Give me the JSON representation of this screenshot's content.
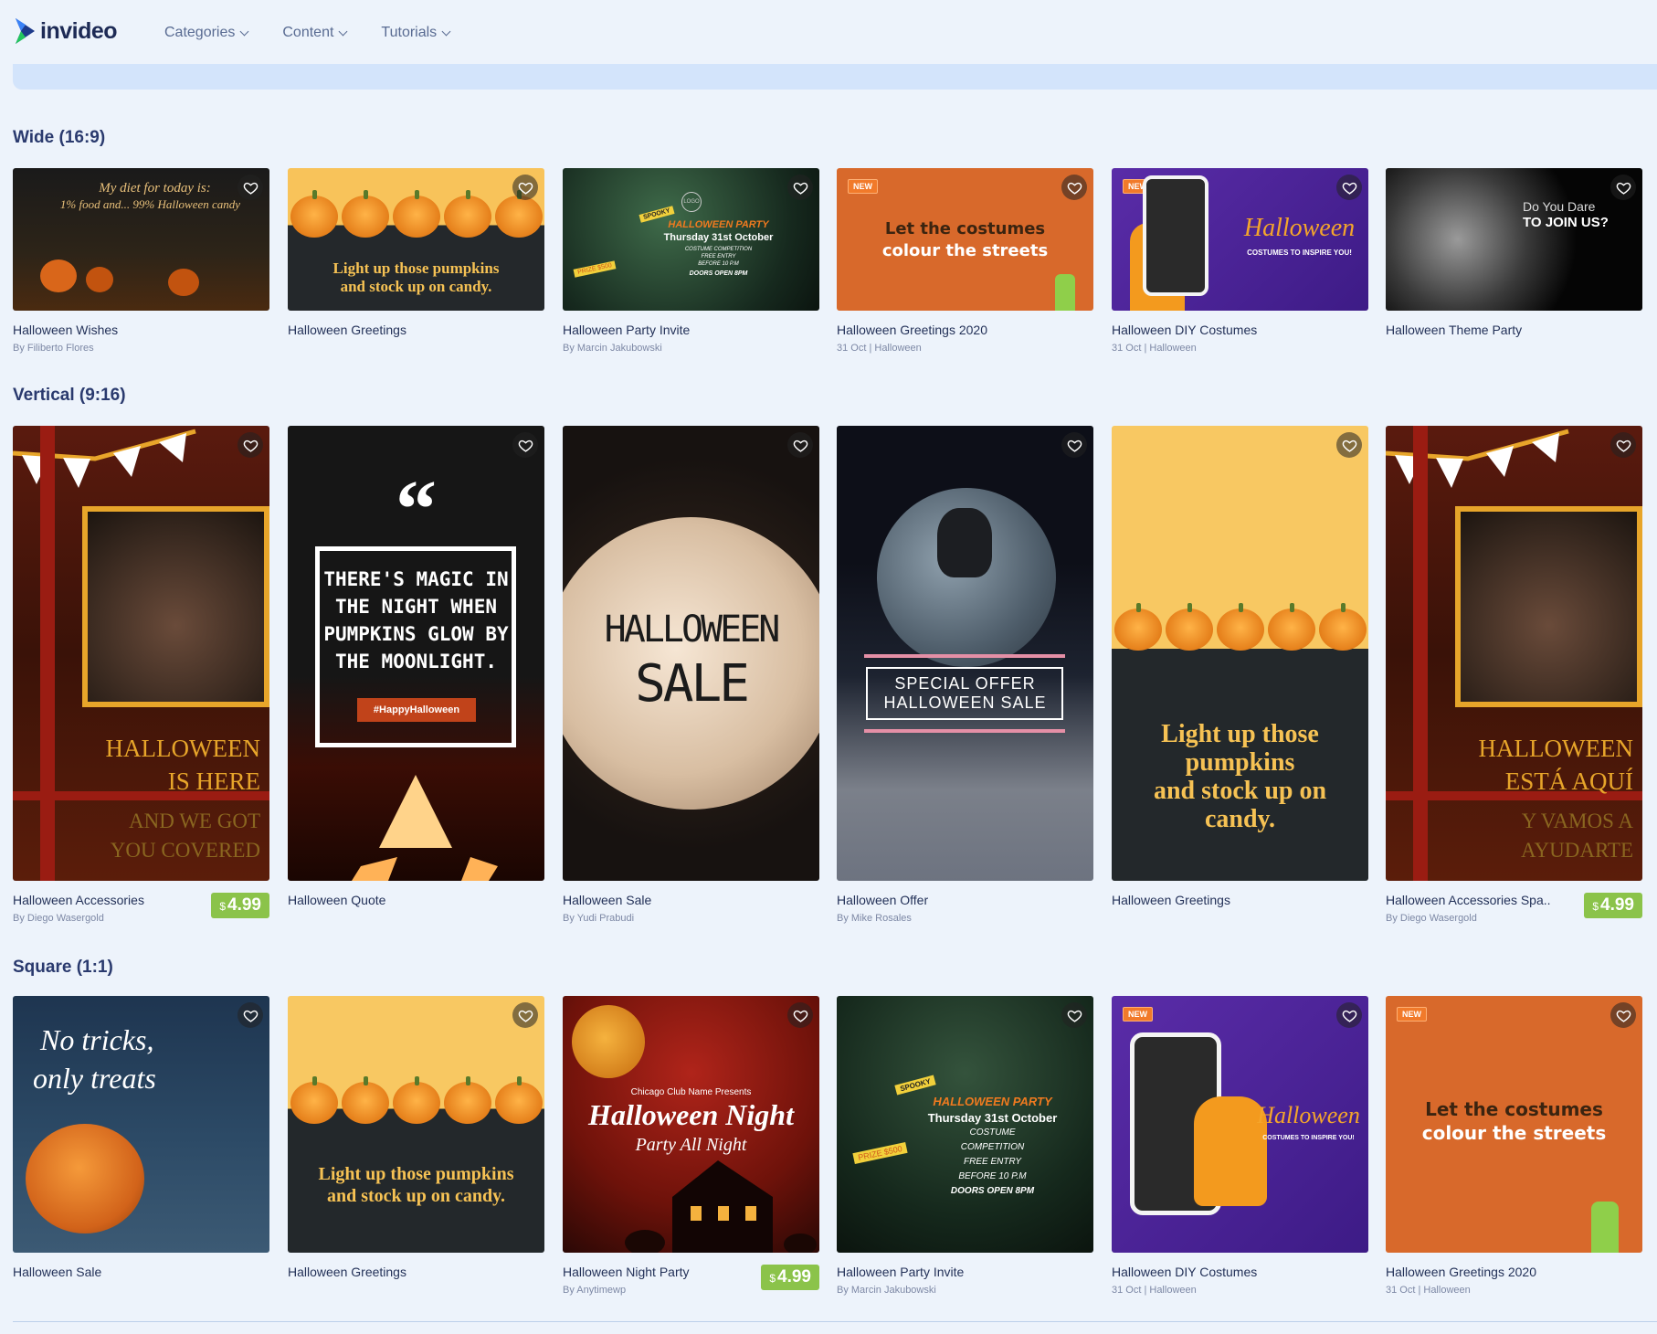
{
  "nav": {
    "logo": "invideo",
    "menu": [
      {
        "label": "Categories"
      },
      {
        "label": "Content"
      },
      {
        "label": "Tutorials"
      }
    ]
  },
  "colors": {
    "background": "#edf3fb",
    "banner": "#d3e4fb",
    "price": "#8bc34a",
    "new_badge": "#f17a2a"
  },
  "sections": {
    "wide": {
      "title": "Wide (16:9)",
      "cards": [
        {
          "title": "Halloween Wishes",
          "sub": "By Filiberto Flores",
          "thumb_text": [
            "My diet for today is:",
            "1% food and... 99% Halloween candy"
          ]
        },
        {
          "title": "Halloween Greetings",
          "sub": "",
          "thumb_text": [
            "Light up those pumpkins",
            "and stock up on candy."
          ]
        },
        {
          "title": "Halloween Party Invite",
          "sub": "By Marcin Jakubowski",
          "thumb_text": [
            "SPOOKY",
            "HALLOWEEN PARTY",
            "Thursday 31st October",
            "COSTUME COMPETITION",
            "FREE ENTRY",
            "BEFORE 10 P.M",
            "DOORS OPEN 8PM",
            "PRIZE $500",
            "LOGO"
          ]
        },
        {
          "title": "Halloween Greetings 2020",
          "sub": "31 Oct | Halloween",
          "badge": "NEW",
          "thumb_text": [
            "Let the costumes",
            "colour the streets"
          ]
        },
        {
          "title": "Halloween DIY Costumes",
          "sub": "31 Oct | Halloween",
          "badge": "NEW",
          "thumb_text": [
            "Halloween",
            "COSTUMES TO INSPIRE YOU!"
          ]
        },
        {
          "title": "Halloween Theme Party",
          "sub": "",
          "thumb_text": [
            "Do You Dare",
            "TO JOIN US?"
          ]
        }
      ]
    },
    "vertical": {
      "title": "Vertical (9:16)",
      "cards": [
        {
          "title": "Halloween Accessories",
          "sub": "By Diego Wasergold",
          "price": {
            "currency": "$",
            "amount": "4.99"
          },
          "thumb_text": [
            "HALLOWEEN",
            "IS HERE",
            "AND WE GOT",
            "YOU COVERED"
          ]
        },
        {
          "title": "Halloween Quote",
          "sub": "",
          "thumb_text": [
            "THERE'S MAGIC IN",
            "THE NIGHT WHEN",
            "PUMPKINS GLOW BY",
            "THE MOONLIGHT.",
            "#HappyHalloween"
          ]
        },
        {
          "title": "Halloween Sale",
          "sub": "By Yudi Prabudi",
          "thumb_text": [
            "HALLOWEEN",
            "SALE"
          ]
        },
        {
          "title": "Halloween Offer",
          "sub": "By Mike Rosales",
          "thumb_text": [
            "SPECIAL OFFER",
            "HALLOWEEN SALE"
          ]
        },
        {
          "title": "Halloween Greetings",
          "sub": "",
          "thumb_text": [
            "Light up those",
            "pumpkins",
            "and stock up on",
            "candy."
          ]
        },
        {
          "title": "Halloween Accessories Spa..",
          "sub": "By Diego Wasergold",
          "price": {
            "currency": "$",
            "amount": "4.99"
          },
          "thumb_text": [
            "HALLOWEEN",
            "ESTÁ AQUÍ",
            "Y VAMOS A",
            "AYUDARTE"
          ]
        }
      ]
    },
    "square": {
      "title": "Square (1:1)",
      "cards": [
        {
          "title": "Halloween Sale",
          "sub": "",
          "thumb_text": [
            "No tricks,",
            "only treats"
          ]
        },
        {
          "title": "Halloween Greetings",
          "sub": "",
          "thumb_text": [
            "Light up those pumpkins",
            "and stock up on candy."
          ]
        },
        {
          "title": "Halloween Night Party",
          "sub": "By Anytimewp",
          "price": {
            "currency": "$",
            "amount": "4.99"
          },
          "thumb_text": [
            "Chicago Club Name Presents",
            "Halloween Night",
            "Party All Night"
          ]
        },
        {
          "title": "Halloween Party Invite",
          "sub": "By Marcin Jakubowski",
          "thumb_text": [
            "SPOOKY",
            "HALLOWEEN PARTY",
            "Thursday 31st October",
            "COSTUME",
            "COMPETITION",
            "FREE ENTRY",
            "BEFORE 10 P.M",
            "DOORS OPEN 8PM",
            "PRIZE $500"
          ]
        },
        {
          "title": "Halloween DIY Costumes",
          "sub": "31 Oct | Halloween",
          "badge": "NEW",
          "thumb_text": [
            "Halloween",
            "COSTUMES TO INSPIRE YOU!"
          ]
        },
        {
          "title": "Halloween Greetings 2020",
          "sub": "31 Oct | Halloween",
          "badge": "NEW",
          "thumb_text": [
            "Let the costumes",
            "colour the streets"
          ]
        }
      ]
    }
  }
}
